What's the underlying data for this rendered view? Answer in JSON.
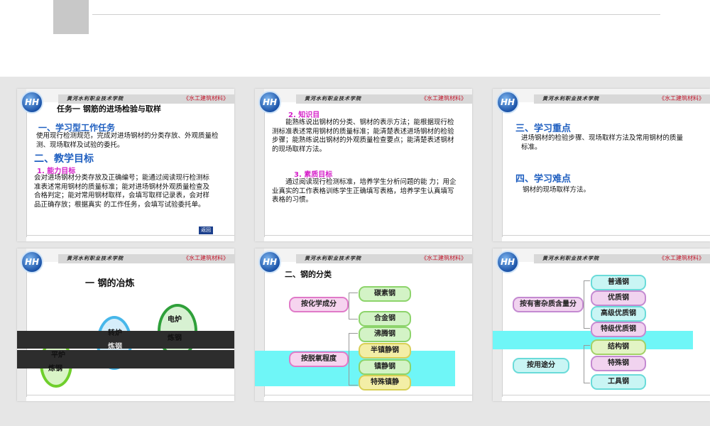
{
  "school": "黄河水利职业技术学院",
  "book": "《水工建筑材料》",
  "logo_text": "HH",
  "colors": {
    "heading_blue": "#1f5fc0",
    "magenta": "#d51ec8",
    "book_red": "#c3162b",
    "cyan_band": "#6ff6f7"
  },
  "slide1": {
    "title": "任务一  钢筋的进场检验与取样",
    "h1": "一、学习型工作任务",
    "p1": "使用现行检测规范，完成对进场钢材的分类存放、外观质量检测、现场取样及试验的委托。",
    "h2": "二、教学目标",
    "sub1": "1. 能力目标",
    "p2": "会对进场钢材分类存放及正确编号；能通过阅读现行检测标准表述常用钢材的质量标准；能对进场钢材外观质量检查及合格判定；能对常用钢材取样，会填写取样记录表，会对样品正确存放；根据真实 的工作任务，会填写试验委托单。",
    "btn": "返回"
  },
  "slide2": {
    "sub2": "2. 知识目",
    "p3": "能熟练说出钢材的分类、钢材的表示方法；能根据现行检测标准表述常用钢材的质量标准；能清楚表述进场钢材的检验步骤；能熟练说出钢材的外观质量检查要点；能清楚表述钢材的现场取样方法。",
    "sub3": "3. 素质目标",
    "p4": "通过阅读现行检测标准，培养学生分析问题的能 力；用企业真实的工作表格训练学生正确填写表格，培养学生认真填写表格的习惯。"
  },
  "slide3": {
    "h3": "三、学习重点",
    "p5": "进场钢材的检验步骤、现场取样方法及常用钢材的质量标准。",
    "h4": "四、学习难点",
    "p6": "钢材的现场取样方法。"
  },
  "slide4": {
    "title": "一  钢的冶炼",
    "c1": "平炉",
    "c1b": "炼钢",
    "c2": "转炉",
    "c2b": "炼钢",
    "c3": "电炉",
    "c3b": "炼钢"
  },
  "slide5": {
    "title": "二、钢的分类",
    "g1": "按化学成分",
    "g1_items": [
      "碳素钢",
      "合金钢"
    ],
    "g2": "按脱氧程度",
    "g2_items": [
      "沸腾钢",
      "半镇静钢",
      "镇静钢",
      "特殊镇静"
    ]
  },
  "slide6": {
    "g3": "按有害杂质含量分",
    "g3_items": [
      "普通钢",
      "优质钢",
      "高级优质钢",
      "特级优质钢"
    ],
    "g4": "按用途分",
    "g4_items": [
      "结构钢",
      "特殊钢",
      "工具钢"
    ]
  }
}
